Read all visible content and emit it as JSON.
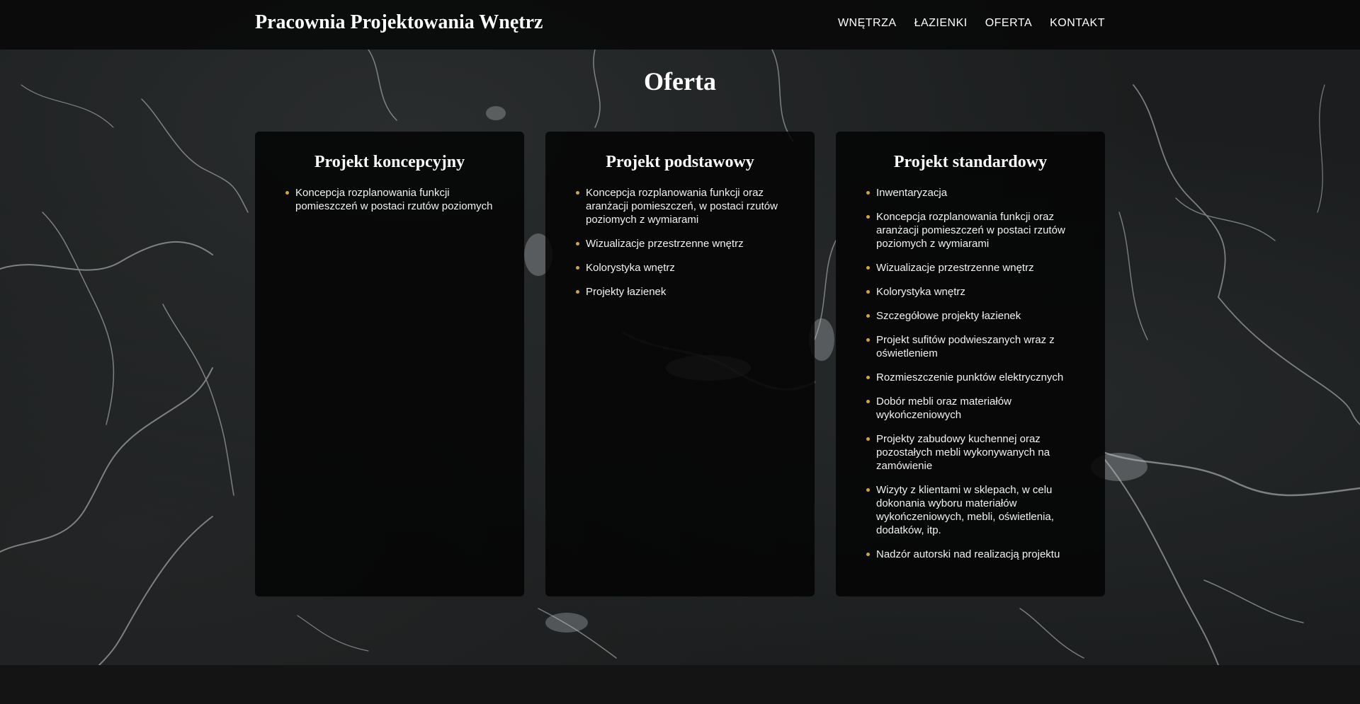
{
  "header": {
    "brand": "Pracownia Projektowania Wnętrz",
    "nav": [
      "WNĘTRZA",
      "ŁAZIENKI",
      "OFERTA",
      "KONTAKT"
    ]
  },
  "section": {
    "title": "Oferta"
  },
  "cards": [
    {
      "title": "Projekt koncepcyjny",
      "items": [
        "Koncepcja rozplanowania funkcji pomieszczeń w postaci rzutów poziomych"
      ]
    },
    {
      "title": "Projekt podstawowy",
      "items": [
        "Koncepcja rozplanowania funkcji oraz aranżacji pomieszczeń, w postaci rzutów poziomych z wymiarami",
        "Wizualizacje przestrzenne wnętrz",
        "Kolorystyka wnętrz",
        "Projekty łazienek"
      ]
    },
    {
      "title": "Projekt standardowy",
      "items": [
        "Inwentaryzacja",
        "Koncepcja rozplanowania funkcji oraz aranżacji pomieszczeń w postaci rzutów poziomych z wymiarami",
        "Wizualizacje przestrzenne wnętrz",
        "Kolorystyka wnętrz",
        "Szczegółowe projekty łazienek",
        "Projekt sufitów podwieszanych wraz z oświetleniem",
        "Rozmieszczenie punktów elektrycznych",
        "Dobór mebli oraz materiałów wykończeniowych",
        "Projekty zabudowy kuchennej oraz pozostałych mebli wykonywanych na zamówienie",
        "Wizyty z klientami w sklepach, w celu dokonania wyboru materiałów wykończeniowych, mebli, oświetlenia, dodatków, itp.",
        "Nadzór autorski nad realizacją projektu"
      ]
    }
  ],
  "colors": {
    "bullet_accent": "#d4a63a",
    "header_bg": "#080808",
    "card_bg": "#040404",
    "marble_bg": "#1b1d1e",
    "footer_bg": "#141414"
  },
  "background": {
    "icon": "marble-texture"
  }
}
